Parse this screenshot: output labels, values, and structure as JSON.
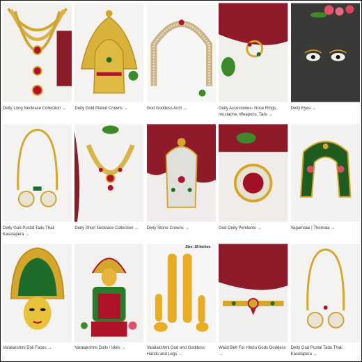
{
  "products": [
    {
      "caption": "Deity Long Necklace Collection →"
    },
    {
      "caption": "Deity Gold Plated Crowns →"
    },
    {
      "caption": "God Goddess Arch →"
    },
    {
      "caption": "Deity Accessories- Nose Rings, mustache, Weapons, Tails →"
    },
    {
      "caption": "Deity Eyes →"
    },
    {
      "caption": "Deity God Pustal Tadu Thali Kasulapera →"
    },
    {
      "caption": "Deity Short Necklace Collection →"
    },
    {
      "caption": "Deity Stone Crowns →"
    },
    {
      "caption": "God Deity Pendants →"
    },
    {
      "caption": "Vagamalai | Thomala →"
    },
    {
      "caption": "Varalakshmi Doll Faces →"
    },
    {
      "caption": "Varalakshmi Dolls / Idols →"
    },
    {
      "caption": "Varalakshmi God and Goddess Hands and Legs →",
      "note": "Size: 18 Inches"
    },
    {
      "caption": "Waist Belt For Hindu Gods Goddess →"
    },
    {
      "caption": "Deity God Pustal Tadu Thali Kasulapera →"
    }
  ],
  "colors": {
    "gold": "#d4a72c",
    "maroon": "#7a1420",
    "ruby": "#b0122a",
    "emerald": "#1f6b2a",
    "leaf": "#3d8a2a"
  }
}
